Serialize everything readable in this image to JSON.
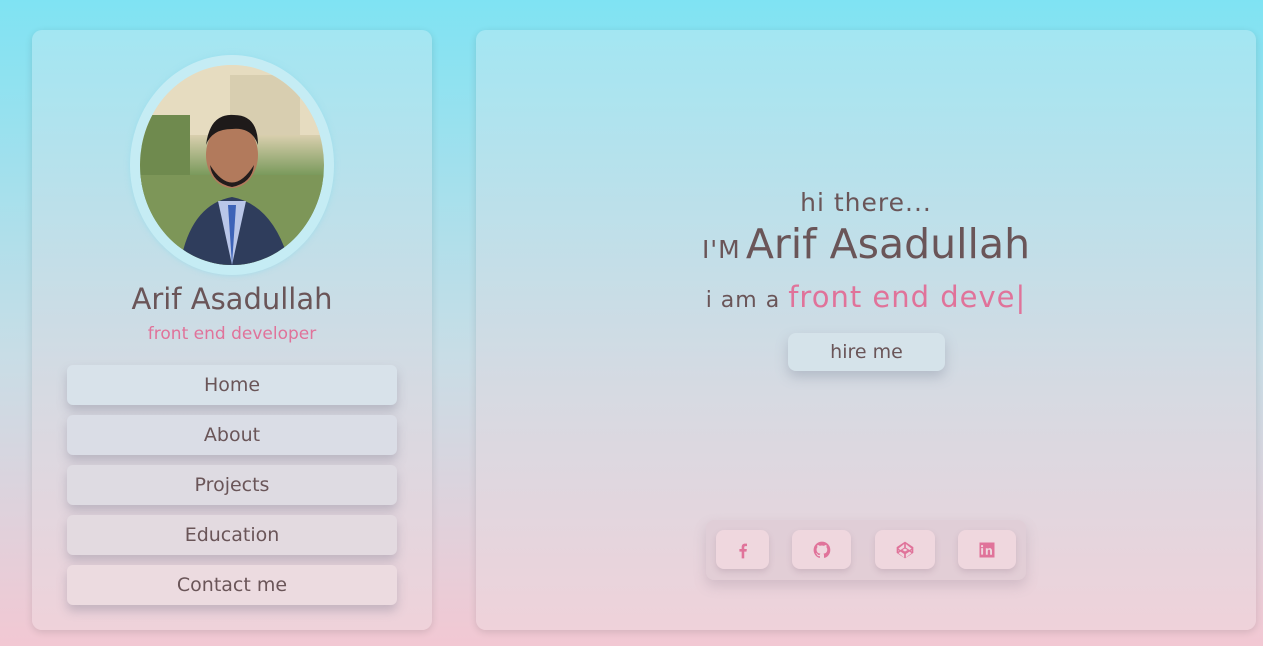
{
  "sidebar": {
    "profile_name": "Arif Asadullah",
    "profile_role": "front end developer",
    "nav": [
      {
        "label": "Home"
      },
      {
        "label": "About"
      },
      {
        "label": "Projects"
      },
      {
        "label": "Education"
      },
      {
        "label": "Contact me"
      }
    ]
  },
  "main": {
    "greeting": "hi there...",
    "im_prefix": "I'M",
    "name": "Arif Asadullah",
    "tagline_prefix": "i am a",
    "typed_text": "front end deve",
    "cursor": "|",
    "hire_label": "hire me",
    "social": [
      {
        "icon": "facebook-icon"
      },
      {
        "icon": "github-icon"
      },
      {
        "icon": "codepen-icon"
      },
      {
        "icon": "linkedin-icon"
      }
    ]
  },
  "colors": {
    "accent": "#e0739a",
    "text": "#6a5558"
  }
}
